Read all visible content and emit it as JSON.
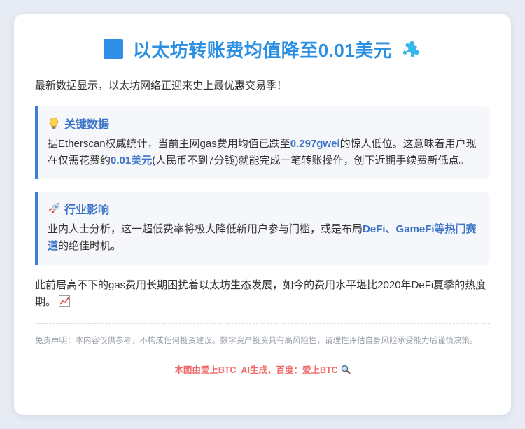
{
  "title": "以太坊转账费均值降至0.01美元",
  "intro": "最新数据显示，以太坊网络正迎来史上最优惠交易季！",
  "key_data": {
    "heading": "关键数据",
    "text_1": "据Etherscan权威统计，当前主网gas费用均值已跌至",
    "highlight_1": "0.297gwei",
    "text_2": "的惊人低位。这意味着用户现在仅需花费约",
    "highlight_2": "0.01美元",
    "text_3": "(人民币不到7分钱)就能完成一笔转账操作，创下近期手续费新低点。"
  },
  "impact": {
    "heading": "行业影响",
    "text_1": "业内人士分析，这一超低费率将极大降低新用户参与门槛，或是布局",
    "highlight_1": "DeFi、GameFi等热门赛道",
    "text_2": "的绝佳时机。"
  },
  "paragraph": "此前居高不下的gas费用长期困扰着以太坊生态发展，如今的费用水平堪比2020年DeFi夏季的热度期。",
  "disclaimer": "免责声明：本内容仅供参考，不构成任何投资建议。数字资产投资具有高风险性，请理性评估自身风险承受能力后谨慎决策。",
  "footer": "本图由爱上BTC_AI生成，百度：爱上BTC",
  "icons": {
    "title_left": "blue-square-icon",
    "title_right": "puzzle-piece-icon",
    "key_data": "lightbulb-icon",
    "impact": "rocket-icon",
    "paragraph": "chart-increasing-icon",
    "footer": "magnifier-icon"
  },
  "colors": {
    "accent": "#2b8fe3",
    "highlight": "#3b74c7",
    "footer": "#f06a6a",
    "background": "#e7ebf3"
  }
}
